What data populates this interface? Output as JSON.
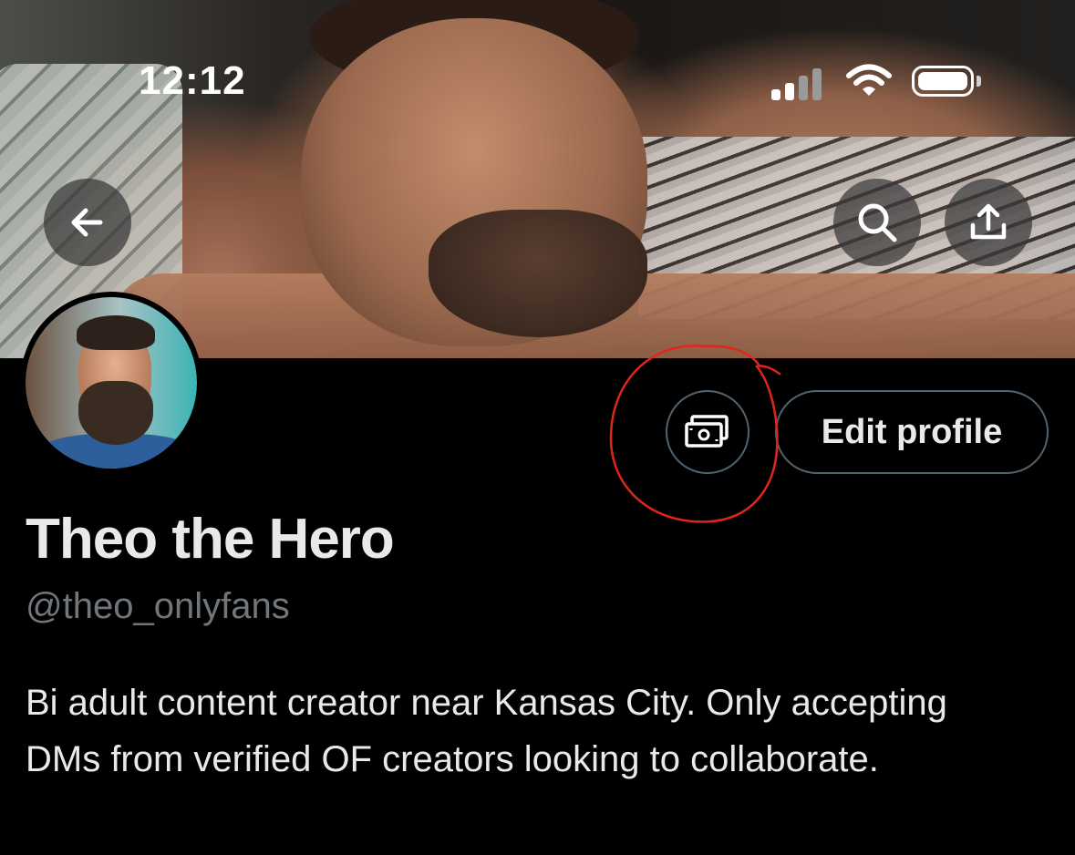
{
  "status_bar": {
    "time": "12:12",
    "signal_icon": "cellular-signal-icon",
    "wifi_icon": "wifi-icon",
    "battery_icon": "battery-icon"
  },
  "header": {
    "back_icon": "back-arrow-icon",
    "search_icon": "search-icon",
    "share_icon": "share-icon"
  },
  "profile": {
    "name": "Theo the Hero",
    "handle": "@theo_onlyfans",
    "bio": "Bi adult content creator near Kansas City. Only accepting DMs from verified OF creators looking to collaborate.",
    "edit_button_label": "Edit profile",
    "money_icon": "money-icon"
  },
  "annotation": {
    "color": "#e0251b"
  }
}
